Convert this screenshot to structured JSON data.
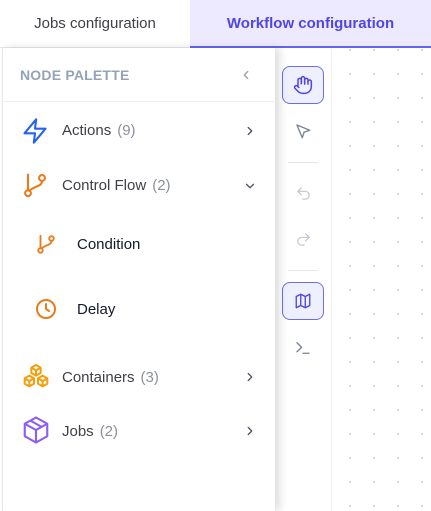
{
  "tabs": [
    {
      "label": "Jobs configuration",
      "active": false
    },
    {
      "label": "Workflow configuration",
      "active": true
    }
  ],
  "palette": {
    "title": "NODE PALETTE",
    "collapse_icon": "chevron-left-icon",
    "categories": [
      {
        "label": "Actions",
        "count": "(9)",
        "icon": "lightning-icon",
        "color": "#2563eb",
        "expanded": false
      },
      {
        "label": "Control Flow",
        "count": "(2)",
        "icon": "git-branch-icon",
        "color": "#ea7a1a",
        "expanded": true,
        "children": [
          {
            "label": "Condition",
            "icon": "git-branch-icon"
          },
          {
            "label": "Delay",
            "icon": "clock-icon"
          }
        ]
      },
      {
        "label": "Containers",
        "count": "(3)",
        "icon": "boxes-icon",
        "color": "#f59e0b",
        "expanded": false
      },
      {
        "label": "Jobs",
        "count": "(2)",
        "icon": "cube-icon",
        "color": "#8b5cf6",
        "expanded": false
      }
    ]
  },
  "toolbar": {
    "tools": [
      {
        "name": "pan-tool",
        "icon": "hand-icon",
        "active": true
      },
      {
        "name": "select-tool",
        "icon": "cursor-arrow-icon",
        "active": false
      },
      {
        "name": "undo",
        "icon": "undo-icon",
        "active": false
      },
      {
        "name": "redo",
        "icon": "redo-icon",
        "active": false
      },
      {
        "name": "minimap-toggle",
        "icon": "map-icon",
        "active": true
      },
      {
        "name": "console-toggle",
        "icon": "terminal-icon",
        "active": false
      }
    ]
  },
  "colors": {
    "accent": "#4f46e5",
    "tab_active_bg": "#ede9fe",
    "muted_text": "#94a3b8"
  }
}
